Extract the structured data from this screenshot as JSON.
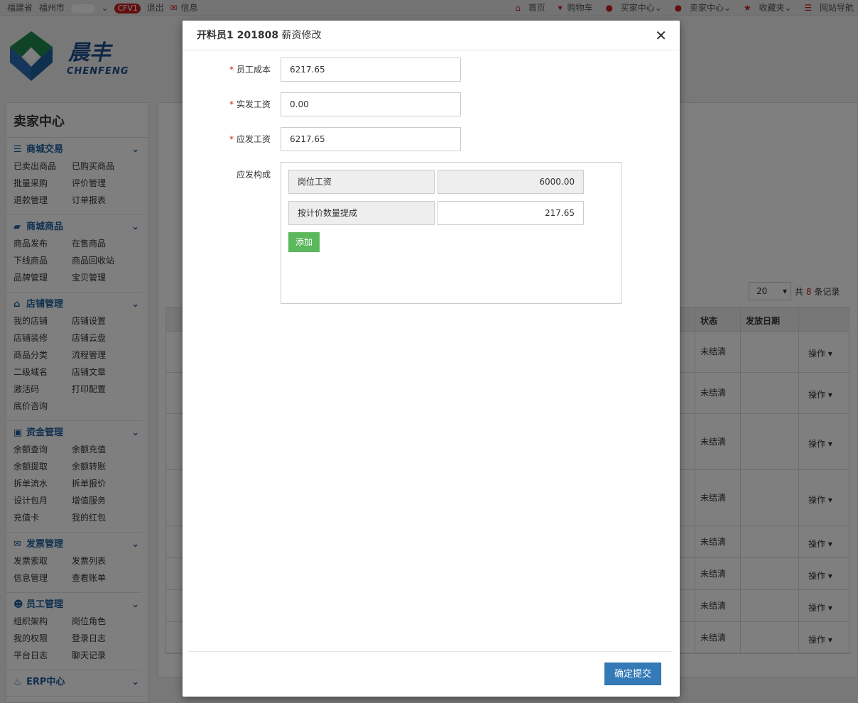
{
  "topbar": {
    "province": "福建省",
    "city": "福州市",
    "version_badge": "CFV1",
    "logout": "退出",
    "message": "信息",
    "nav": [
      "首页",
      "购物车",
      "买家中心",
      "卖家中心",
      "收藏夹",
      "网站导航"
    ]
  },
  "logo": {
    "cn": "晨丰",
    "en": "CHENFENG"
  },
  "sidebar": {
    "title": "卖家中心",
    "groups": [
      {
        "name": "商城交易",
        "icon": "list-icon",
        "items": [
          "已卖出商品",
          "已购买商品",
          "批量采购",
          "评价管理",
          "退款管理",
          "订单报表"
        ]
      },
      {
        "name": "商城商品",
        "icon": "truck-icon",
        "items": [
          "商品发布",
          "在售商品",
          "下线商品",
          "商品回收站",
          "品牌管理",
          "宝贝管理"
        ]
      },
      {
        "name": "店铺管理",
        "icon": "home-icon",
        "items": [
          "我的店铺",
          "店铺设置",
          "店铺装修",
          "店铺云盘",
          "商品分类",
          "流程管理",
          "二级域名",
          "店铺文章",
          "激活码",
          "打印配置",
          "底价咨询"
        ]
      },
      {
        "name": "资金管理",
        "icon": "money-icon",
        "items": [
          "余额查询",
          "余额充值",
          "余额提取",
          "余额转账",
          "拆单流水",
          "拆单报价",
          "设计包月",
          "增值服务",
          "充值卡",
          "我的红包"
        ]
      },
      {
        "name": "发票管理",
        "icon": "envelope-icon",
        "items": [
          "发票索取",
          "发票列表",
          "信息管理",
          "查看账单"
        ]
      },
      {
        "name": "员工管理",
        "icon": "users-icon",
        "items": [
          "组织架构",
          "岗位角色",
          "我的权限",
          "登录日志",
          "平台日志",
          "聊天记录"
        ]
      },
      {
        "name": "ERP中心",
        "icon": "fire-icon",
        "items": []
      }
    ]
  },
  "background": {
    "page_size": "20",
    "total_prefix": "共",
    "total_count": "8",
    "total_suffix": "条记录",
    "col_status": "状态",
    "col_date": "发放日期",
    "currency": "¥",
    "rows": [
      {
        "status": "未结清",
        "op": "操作"
      },
      {
        "status": "未结清",
        "op": "操作"
      },
      {
        "status": "未结清",
        "op": "操作"
      },
      {
        "status": "未结清",
        "op": "操作"
      },
      {
        "status": "未结清",
        "op": "操作"
      },
      {
        "status": "未结清",
        "op": "操作"
      },
      {
        "status": "未结清",
        "op": "操作"
      },
      {
        "status": "未结清",
        "op": "操作"
      }
    ]
  },
  "modal": {
    "title_bold": "开料员1 201808",
    "title_rest": "薪资修改",
    "fields": [
      {
        "label": "员工成本",
        "value": "6217.65"
      },
      {
        "label": "实发工资",
        "value": "0.00"
      },
      {
        "label": "应发工资",
        "value": "6217.65"
      }
    ],
    "composition_label": "应发构成",
    "components": [
      {
        "name": "岗位工资",
        "value": "6000.00"
      },
      {
        "name": "按计价数量提成",
        "value": "217.65"
      }
    ],
    "add_button": "添加",
    "submit_button": "确定提交"
  }
}
